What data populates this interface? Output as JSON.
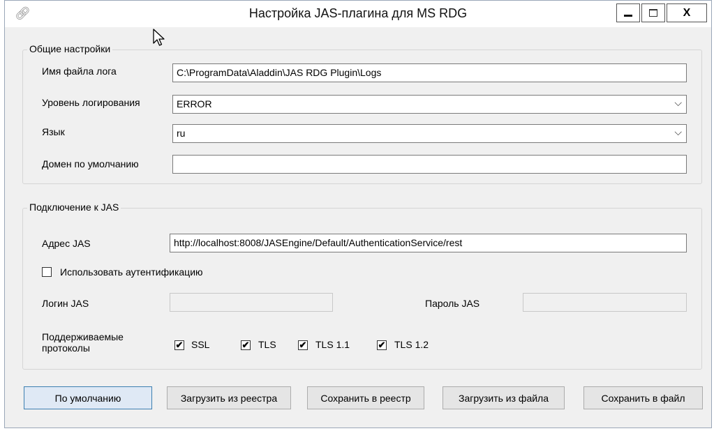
{
  "window": {
    "title": "Настройка JAS-плагина для MS RDG",
    "icon": "chain-link-icon",
    "controls": {
      "close_label": "X"
    }
  },
  "general": {
    "legend": "Общие настройки",
    "log_file_label": "Имя файла лога",
    "log_file_value": "C:\\ProgramData\\Aladdin\\JAS RDG Plugin\\Logs",
    "log_level_label": "Уровень логирования",
    "log_level_value": "ERROR",
    "language_label": "Язык",
    "language_value": "ru",
    "default_domain_label": "Домен по умолчанию",
    "default_domain_value": ""
  },
  "jas": {
    "legend": "Подключение к JAS",
    "address_label": "Адрес JAS",
    "address_value": "http://localhost:8008/JASEngine/Default/AuthenticationService/rest",
    "use_auth_label": "Использовать аутентификацию",
    "use_auth_checked": false,
    "login_label": "Логин JAS",
    "login_value": "",
    "password_label": "Пароль JAS",
    "password_value": "",
    "protocols_label_line1": "Поддерживаемые",
    "protocols_label_line2": "протоколы",
    "protocols": [
      {
        "label": "SSL",
        "checked": true
      },
      {
        "label": "TLS",
        "checked": true
      },
      {
        "label": "TLS 1.1",
        "checked": true
      },
      {
        "label": "TLS 1.2",
        "checked": true
      }
    ],
    "check_mark": "✔"
  },
  "buttons": {
    "defaults": "По умолчанию",
    "load_registry": "Загрузить из реестра",
    "save_registry": "Сохранить в реестр",
    "load_file": "Загрузить из файла",
    "save_file": "Сохранить в файл"
  }
}
